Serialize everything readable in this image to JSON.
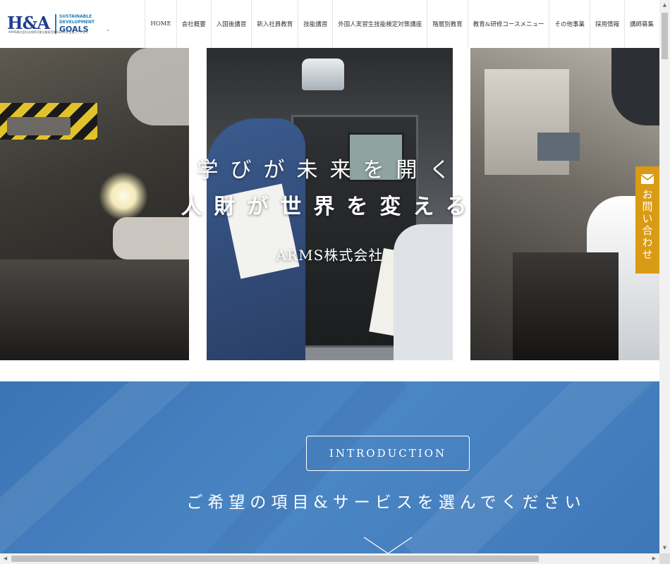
{
  "logo": {
    "brand": "H&A",
    "sdg_lines": [
      "SUSTAINABLE",
      "DEVELOPMENT",
      "GOALS"
    ],
    "tagline": "ARMS株式会社は持続可能な開発目標(SDGs)を支援しています"
  },
  "nav": {
    "items": [
      {
        "label": "HOME"
      },
      {
        "label": "会社概要"
      },
      {
        "label": "入国後講習"
      },
      {
        "label": "新入社員教育"
      },
      {
        "label": "技能講習"
      },
      {
        "label": "外国人実習生技能検定対策講座"
      },
      {
        "label": "階層別教育"
      },
      {
        "label": "教育&研修コースメニュー"
      },
      {
        "label": "その他事業"
      },
      {
        "label": "採用情報"
      },
      {
        "label": "講師募集"
      }
    ]
  },
  "hero": {
    "line1": "学びが未来を開く",
    "line2": "人財が世界を変える",
    "company": "ARMS株式会社"
  },
  "contact_tab": {
    "label": "お問い合わせ",
    "icon": "envelope-icon"
  },
  "intro": {
    "button_label": "INTRODUCTION",
    "prompt": "ご希望の項目&サービスを選んでください"
  },
  "colors": {
    "accent_blue": "#3f78b8",
    "contact_orange": "#d99a14",
    "brand_navy": "#1f3f8f"
  }
}
